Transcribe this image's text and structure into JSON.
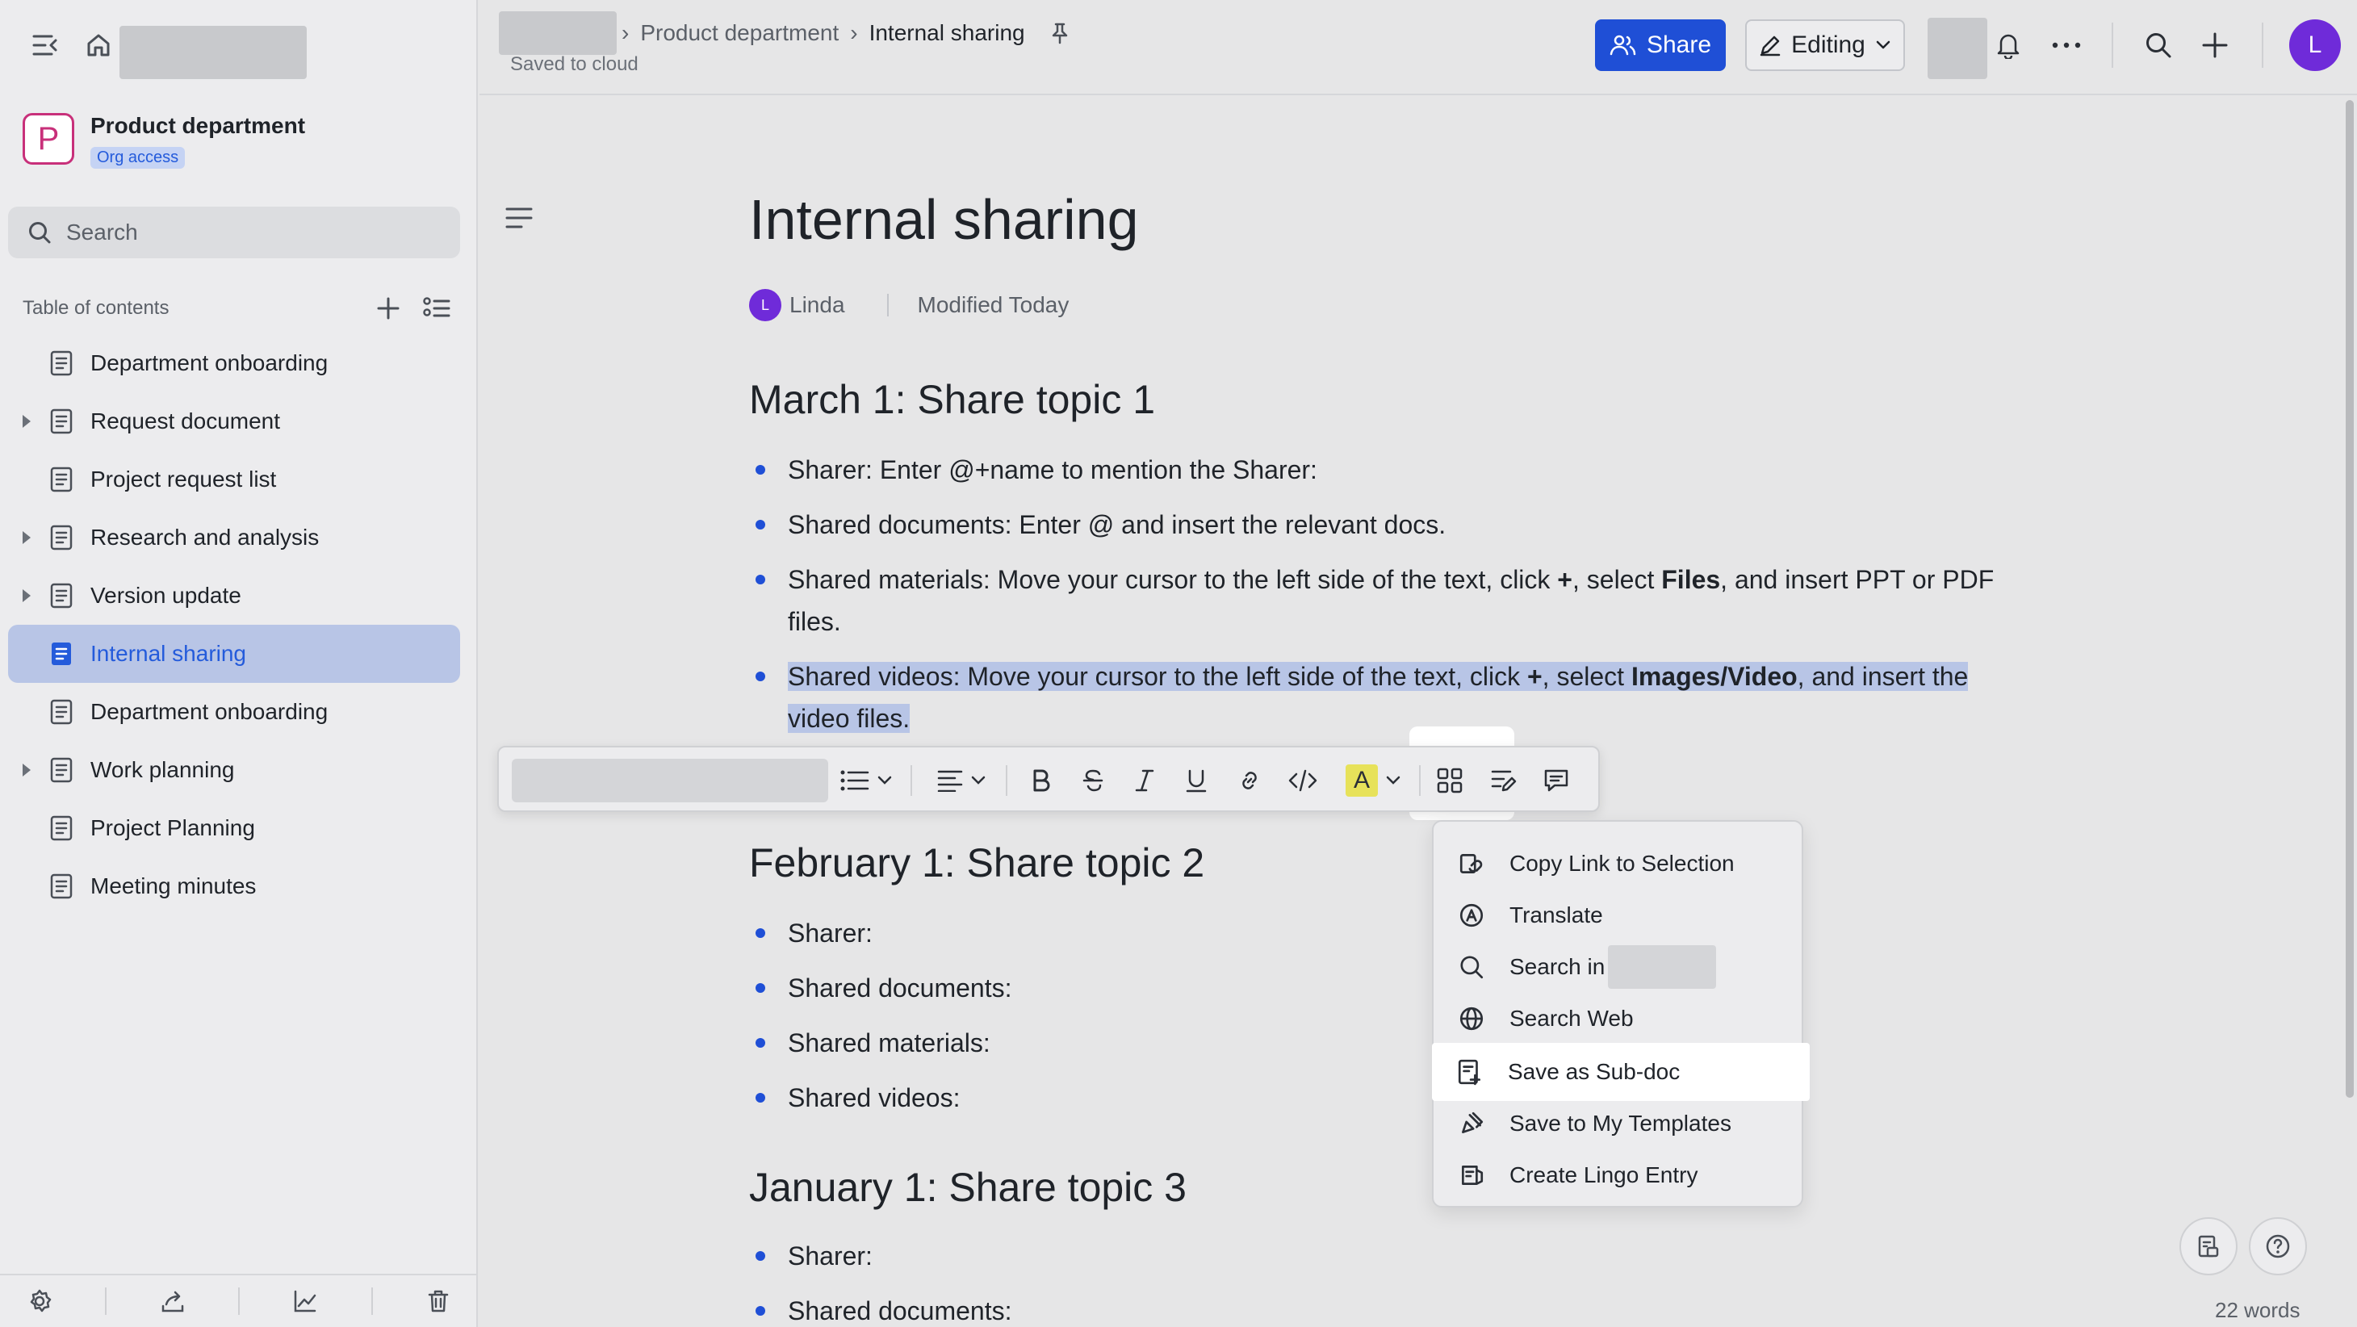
{
  "sidebar": {
    "space": {
      "avatar_letter": "P",
      "name": "Product department",
      "badge": "Org access"
    },
    "search": {
      "placeholder": "Search"
    },
    "toc": {
      "title": "Table of contents",
      "items": [
        {
          "label": "Department onboarding",
          "expandable": false
        },
        {
          "label": "Request document",
          "expandable": true
        },
        {
          "label": "Project request list",
          "expandable": false
        },
        {
          "label": "Research and analysis",
          "expandable": true
        },
        {
          "label": "Version update",
          "expandable": true
        },
        {
          "label": "Internal sharing",
          "expandable": false,
          "active": true
        },
        {
          "label": "Department onboarding",
          "expandable": false
        },
        {
          "label": "Work planning",
          "expandable": true
        },
        {
          "label": "Project Planning",
          "expandable": false
        },
        {
          "label": "Meeting minutes",
          "expandable": false
        }
      ]
    }
  },
  "header": {
    "breadcrumb": {
      "parent": "Product department",
      "current": "Internal sharing"
    },
    "saved_status": "Saved to cloud",
    "share_label": "Share",
    "editing_label": "Editing",
    "user_initial": "L"
  },
  "doc": {
    "title": "Internal sharing",
    "author_initial": "L",
    "author": "Linda",
    "modified": "Modified Today",
    "sections": [
      {
        "heading": "March 1: Share topic 1",
        "bullets": [
          "Sharer: Enter @+name to mention the Sharer:",
          "Shared documents: Enter @ and insert the relevant docs.",
          {
            "pre": "Shared materials: Move your cursor to the left side of the text, click ",
            "b1": "+",
            "mid": ", select ",
            "b2": "Files",
            "post": ", and insert PPT or PDF files."
          },
          {
            "pre": "Shared videos: Move your cursor to the left side of the text, click ",
            "b1": "+",
            "mid": ", select ",
            "b2": "Images/Video",
            "post": ", and insert the video files."
          }
        ]
      },
      {
        "heading": "February 1: Share topic 2",
        "bullets": [
          "Sharer:",
          "Shared documents:",
          "Shared materials:",
          "Shared videos:"
        ]
      },
      {
        "heading": "January 1: Share topic 3",
        "bullets": [
          "Sharer:",
          "Shared documents:"
        ]
      }
    ]
  },
  "menu": {
    "items": [
      {
        "label": "Copy Link to Selection",
        "icon": "link-copy-icon"
      },
      {
        "label": "Translate",
        "icon": "translate-icon"
      },
      {
        "label": "Search in",
        "icon": "search-icon"
      },
      {
        "label": "Search Web",
        "icon": "globe-icon"
      },
      {
        "label": "Save as Sub-doc",
        "icon": "sub-doc-icon"
      },
      {
        "label": "Save to My Templates",
        "icon": "template-icon"
      },
      {
        "label": "Create Lingo Entry",
        "icon": "lingo-icon"
      }
    ]
  },
  "footer": {
    "word_count": "22 words"
  },
  "colors": {
    "accent": "#1f4fd6",
    "selection": "#b8c5e6",
    "avatar": "#6f2bd9",
    "space": "#c8307a"
  }
}
